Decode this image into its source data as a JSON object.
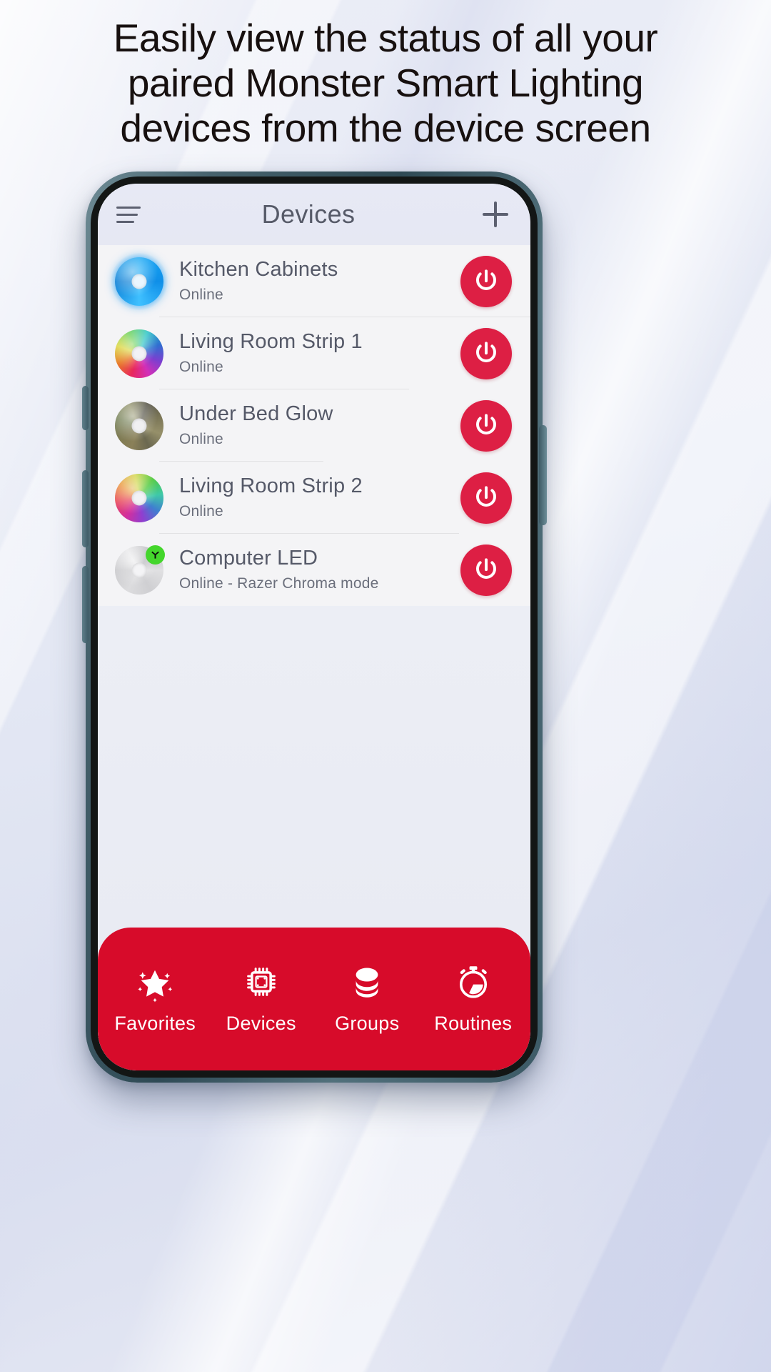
{
  "headline": {
    "line1": "Easily view the status of all your",
    "line2": "paired Monster Smart Lighting",
    "line3": "devices from the device screen"
  },
  "colors": {
    "brand_red": "#d70b2a",
    "power_button_red": "#dd1f44",
    "razer_green": "#44d62c",
    "header_text": "#565a68",
    "device_name_text": "#555968",
    "frame_teal": "#3d5a65"
  },
  "app": {
    "header": {
      "menu_icon": "hamburger-icon",
      "title": "Devices",
      "add_icon": "plus-icon"
    },
    "devices": [
      {
        "name": "Kitchen Cabinets",
        "status": "Online",
        "icon": "light-ring-blue",
        "color_mode": "solid-blue",
        "badge": null,
        "power_icon": "power-icon"
      },
      {
        "name": "Living Room Strip 1",
        "status": "Online",
        "icon": "light-ring-rainbow",
        "color_mode": "rainbow",
        "badge": null,
        "power_icon": "power-icon"
      },
      {
        "name": "Under Bed Glow",
        "status": "Online",
        "icon": "light-ring-dim",
        "color_mode": "dim-olive",
        "badge": null,
        "power_icon": "power-icon"
      },
      {
        "name": "Living Room Strip 2",
        "status": "Online",
        "icon": "light-ring-rainbow",
        "color_mode": "rainbow",
        "badge": null,
        "power_icon": "power-icon"
      },
      {
        "name": "Computer LED",
        "status": "Online - Razer Chroma mode",
        "icon": "light-ring-white",
        "color_mode": "white",
        "badge": "razer-chroma-badge",
        "power_icon": "power-icon"
      }
    ],
    "bottom_nav": [
      {
        "label": "Favorites",
        "icon": "star-sparkle-icon",
        "active": false
      },
      {
        "label": "Devices",
        "icon": "chip-icon",
        "active": true
      },
      {
        "label": "Groups",
        "icon": "stack-layers-icon",
        "active": false
      },
      {
        "label": "Routines",
        "icon": "stopwatch-icon",
        "active": false
      }
    ]
  }
}
